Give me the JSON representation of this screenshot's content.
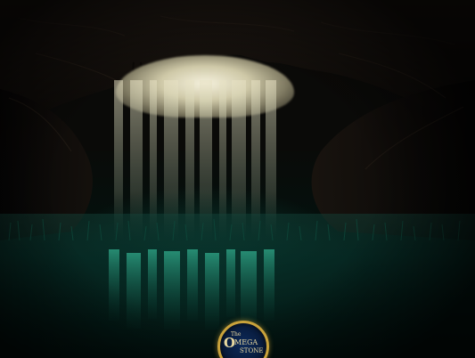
{
  "scene": {
    "type": "underground cave with light beams over green water",
    "colors": {
      "water": "#0f6b58",
      "light": "#f4f0dc",
      "rock": "#1a140f",
      "logo_ring": "#c9a23b",
      "logo_fill": "#0d2a5a"
    }
  },
  "logo": {
    "line1": "The",
    "line2": "MEGA",
    "line3": "STONE",
    "initial": "O"
  }
}
